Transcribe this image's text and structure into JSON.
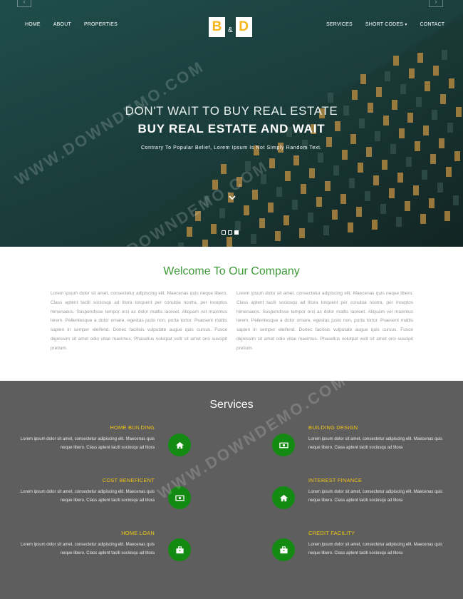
{
  "nav": {
    "left": [
      "HOME",
      "ABOUT",
      "PROPERTIES"
    ],
    "right": [
      "SERVICES",
      "SHORT CODES",
      "CONTACT"
    ],
    "caret": "▾"
  },
  "logo": {
    "letter1": "B",
    "amp": "&",
    "letter2": "D"
  },
  "hero": {
    "title1": "DON'T WAIT TO BUY REAL ESTATE",
    "title2": "BUY REAL ESTATE AND WAIT",
    "subtitle": "Contrary To Popular Belief, Lorem Ipsum Is Not Simply Random Text.",
    "chevron": "⌄"
  },
  "welcome": {
    "title": "Welcome To Our Company",
    "col_left": "Lorem ipsum dolor sit amet, consectetur adipiscing elit. Maecenas quis neque libero. Class aptent taciti sociosqu ad litora torquent per conubia nostra, per inceptos himenaeos. Suspendisse tempor orci ac dolor mattis laoreet. Aliquam vel maximus lorem. Pellentesque a dolor ornare, egestas justo non, porta tortor. Praesent mattis sapien in semper eleifend. Donec facilisis vulputate augue quis cursus. Fusce dignissim sit amet odio vitae maximus. Phasellus volutpat velit sit amet orci suscipit pretium.",
    "col_right": "Lorem ipsum dolor sit amet, consectetur adipiscing elit. Maecenas quis neque libero. Class aptent taciti sociosqu ad litora torquent per conubia nostra, per inceptos himenaeos. Suspendisse tempor orci ac dolor mattis laoreet. Aliquam vel maximus lorem. Pellentesque a dolor ornare, egestas justo non, porta tortor. Praesent mattis sapien in semper eleifend. Donec facilisis vulputate augue quis cursus. Fusce dignissim sit amet odio vitae maximus. Phasellus volutpat velit sit amet orci suscipit pretium."
  },
  "services": {
    "title": "Services",
    "items": [
      {
        "title": "HOME BUILDING",
        "desc": "Lorem ipsum dolor sit amet, consectetur adipiscing elit. Maecenas quis neque libero. Class aptent taciti sociosqu ad litora",
        "icon": "home-icon"
      },
      {
        "title": "BUILDING DESIGN",
        "desc": "Lorem ipsum dolor sit amet, consectetur adipiscing elit. Maecenas quis neque libero. Class aptent taciti sociosqu ad litora",
        "icon": "money-icon"
      },
      {
        "title": "COST BENEFICENT",
        "desc": "Lorem ipsum dolor sit amet, consectetur adipiscing elit. Maecenas quis neque libero. Class aptent taciti sociosqu ad litora",
        "icon": "money-icon"
      },
      {
        "title": "INTEREST FINANCE",
        "desc": "Lorem ipsum dolor sit amet, consectetur adipiscing elit. Maecenas quis neque libero. Class aptent taciti sociosqu ad litora",
        "icon": "home-icon"
      },
      {
        "title": "HOME LOAN",
        "desc": "Lorem ipsum dolor sit amet, consectetur adipiscing elit. Maecenas quis neque libero. Class aptent taciti sociosqu ad litora",
        "icon": "briefcase-icon"
      },
      {
        "title": "CREDIT FACILITY",
        "desc": "Lorem ipsum dolor sit amet, consectetur adipiscing elit. Maecenas quis neque libero. Class aptent taciti sociosqu ad litora",
        "icon": "briefcase-icon"
      }
    ]
  },
  "carousel": {
    "slides": 3,
    "active": 3
  },
  "watermark": "WWW.DOWNDEMO.COM",
  "colors": {
    "accent_green": "#3f9a3a",
    "icon_green": "#138a12",
    "gold": "#f2c614",
    "logo_gold": "#f5b51b",
    "services_bg": "#5e5e5e"
  }
}
